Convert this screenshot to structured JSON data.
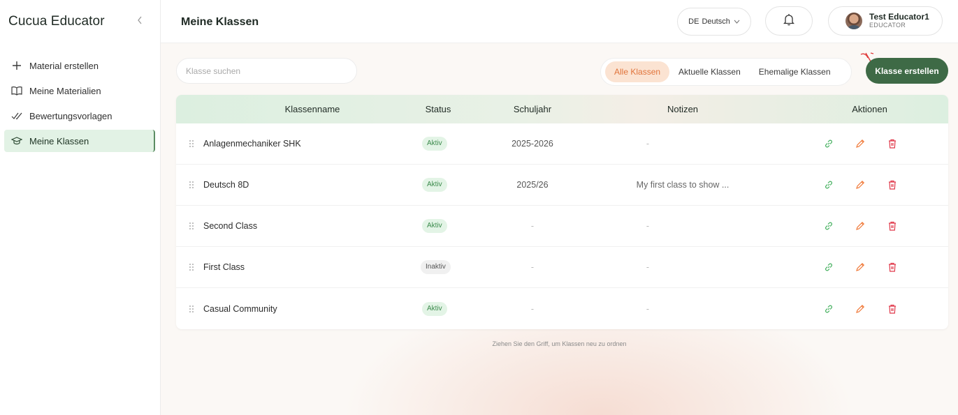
{
  "sidebar": {
    "brand": "Cucua Educator",
    "collapse_icon": "chevron-left-icon",
    "items": [
      {
        "label": "Material erstellen",
        "icon": "plus-icon",
        "active": false
      },
      {
        "label": "Meine Materialien",
        "icon": "book-icon",
        "active": false
      },
      {
        "label": "Bewertungsvorlagen",
        "icon": "check-double-icon",
        "active": false
      },
      {
        "label": "Meine Klassen",
        "icon": "graduation-cap-icon",
        "active": true
      }
    ]
  },
  "header": {
    "title": "Meine Klassen",
    "language": {
      "code": "DE",
      "label": "Deutsch"
    },
    "user": {
      "name": "Test Educator1",
      "role": "EDUCATOR"
    }
  },
  "toolbar": {
    "search_placeholder": "Klasse suchen",
    "filters": [
      {
        "label": "Alle Klassen",
        "active": true
      },
      {
        "label": "Aktuelle Klassen",
        "active": false
      },
      {
        "label": "Ehemalige Klassen",
        "active": false
      }
    ],
    "create_label": "Klasse erstellen"
  },
  "table": {
    "columns": [
      "Klassenname",
      "Status",
      "Schuljahr",
      "Notizen",
      "Aktionen"
    ],
    "rows": [
      {
        "name": "Anlagenmechaniker SHK",
        "status": "Aktiv",
        "year": "2025-2026",
        "notes": "-"
      },
      {
        "name": "Deutsch 8D",
        "status": "Aktiv",
        "year": "2025/26",
        "notes": "My first class to show ..."
      },
      {
        "name": "Second Class",
        "status": "Aktiv",
        "year": "-",
        "notes": "-"
      },
      {
        "name": "First Class",
        "status": "Inaktiv",
        "year": "-",
        "notes": "-"
      },
      {
        "name": "Casual Community",
        "status": "Aktiv",
        "year": "-",
        "notes": "-"
      }
    ]
  },
  "hint": "Ziehen Sie den Griff, um Klassen neu zu ordnen",
  "colors": {
    "accent": "#3e6a46",
    "active_filter_bg": "#fbe3d2",
    "active_filter_text": "#e0733a",
    "link_icon": "#3fae5a",
    "edit_icon": "#f07a3a",
    "delete_icon": "#e0384a"
  }
}
